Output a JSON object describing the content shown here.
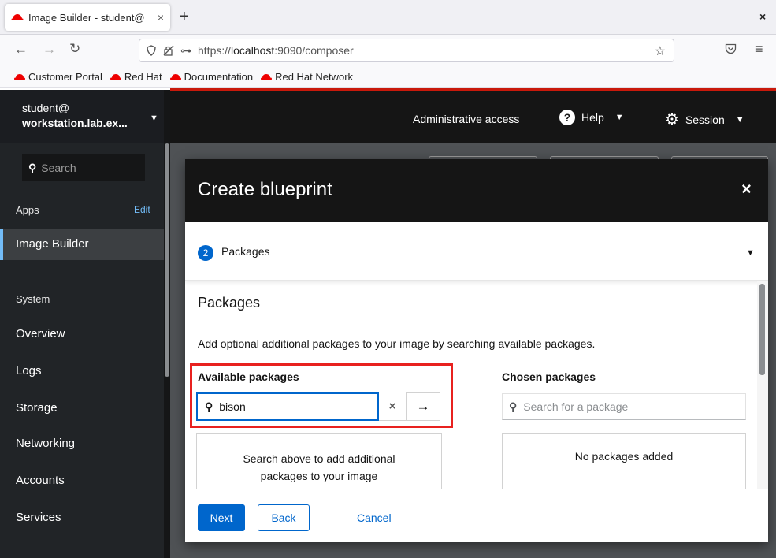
{
  "browser": {
    "tab_title": "Image Builder - student@",
    "tab_close": "×",
    "new_tab": "+",
    "window_close": "×",
    "url_prefix": "https://",
    "url_host": "localhost",
    "url_path": ":9090/composer",
    "bookmarks": [
      {
        "label": "Customer Portal"
      },
      {
        "label": "Red Hat"
      },
      {
        "label": "Documentation"
      },
      {
        "label": "Red Hat Network"
      }
    ]
  },
  "sidebar": {
    "host_line1": "student@",
    "host_line2": "workstation.lab.ex...",
    "search_placeholder": "Search",
    "apps_label": "Apps",
    "edit_label": "Edit",
    "active_item": "Image Builder",
    "system_label": "System",
    "items": [
      "Overview",
      "Logs",
      "Storage",
      "Networking",
      "Accounts",
      "Services"
    ]
  },
  "topbar": {
    "admin": "Administrative access",
    "help": "Help",
    "session": "Session"
  },
  "modal": {
    "title": "Create blueprint",
    "close": "×",
    "step_number": "2",
    "step_label": "Packages",
    "section_title": "Packages",
    "description": "Add optional additional packages to your image by searching available packages.",
    "available_label": "Available packages",
    "available_search_value": "bison",
    "clear": "×",
    "go": "→",
    "chosen_label": "Chosen packages",
    "chosen_search_placeholder": "Search for a package",
    "available_empty_line1": "Search above to add additional",
    "available_empty_line2": "packages to your image",
    "chosen_empty": "No packages added",
    "next": "Next",
    "back": "Back",
    "cancel": "Cancel"
  },
  "colors": {
    "accent": "#0066cc",
    "highlight": "#e8211f",
    "redhat": "#ee0000",
    "sidebar_bg": "#212427",
    "topbar_bg": "#151515"
  }
}
